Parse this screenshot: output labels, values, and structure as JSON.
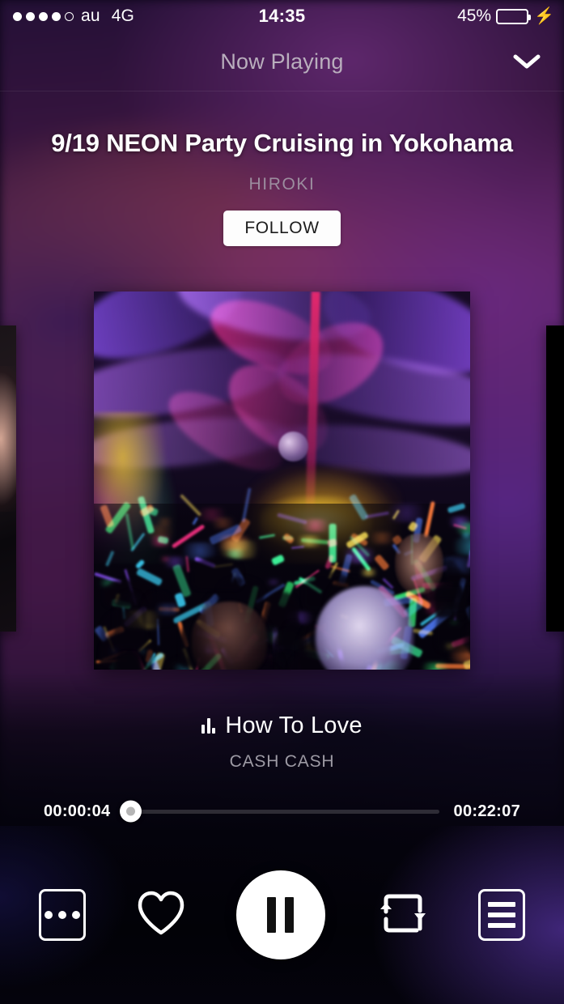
{
  "status_bar": {
    "signal_dots_total": 5,
    "signal_dots_filled": 4,
    "carrier": "au",
    "network": "4G",
    "time": "14:35",
    "battery_percent": "45%",
    "battery_level": 45,
    "charging_icon": "⚡",
    "battery_color": "#3fd13f"
  },
  "nav": {
    "title": "Now Playing",
    "collapse_icon": "chevron-down-icon"
  },
  "event": {
    "title": "9/19 NEON Party Cruising in Yokohama",
    "artist": "HIROKI",
    "follow_label": "FOLLOW"
  },
  "artwork": {
    "alt": "Neon party crowd with purple and magenta streamers",
    "peek_left": "previous-artwork",
    "peek_right": "next-artwork"
  },
  "track": {
    "equalizer_icon": "equalizer-icon",
    "title": "How To Love",
    "artist": "CASH CASH"
  },
  "progress": {
    "elapsed": "00:00:04",
    "duration": "00:22:07",
    "percent": 0.3
  },
  "controls": {
    "more_label": "more-options",
    "like_label": "like",
    "play_state": "pause",
    "repeat_label": "repeat",
    "queue_label": "queue"
  },
  "colors": {
    "accent_white": "#ffffff",
    "muted_text": "#9c8d9f",
    "battery_green": "#3fd13f",
    "background_top": "#3a1540",
    "background_mid": "#5d2352",
    "background_bottom": "#04030c"
  }
}
